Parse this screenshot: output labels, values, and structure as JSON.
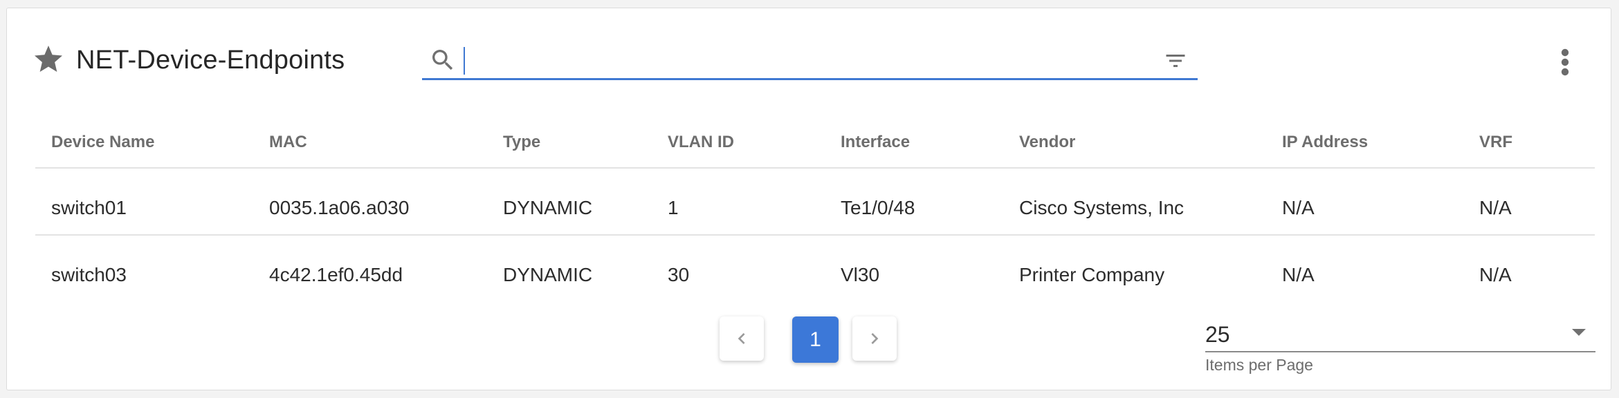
{
  "header": {
    "title": "NET-Device-Endpoints",
    "search_value": "",
    "star_icon": "star-icon",
    "search_icon": "search-icon",
    "filter_icon": "filter-icon",
    "more_icon": "more-vert-icon"
  },
  "table": {
    "columns": [
      "Device Name",
      "MAC",
      "Type",
      "VLAN ID",
      "Interface",
      "Vendor",
      "IP Address",
      "VRF"
    ],
    "rows": [
      [
        "switch01",
        "0035.1a06.a030",
        "DYNAMIC",
        "1",
        "Te1/0/48",
        "Cisco Systems, Inc",
        "N/A",
        "N/A"
      ],
      [
        "switch03",
        "4c42.1ef0.45dd",
        "DYNAMIC",
        "30",
        "Vl30",
        "Printer Company",
        "N/A",
        "N/A"
      ]
    ]
  },
  "pagination": {
    "current_page": "1",
    "items_per_page": "25",
    "items_per_page_label": "Items per Page"
  },
  "colors": {
    "accent": "#3c78d8",
    "text": "#2c2c2c",
    "header_text": "#6d6d6d"
  }
}
